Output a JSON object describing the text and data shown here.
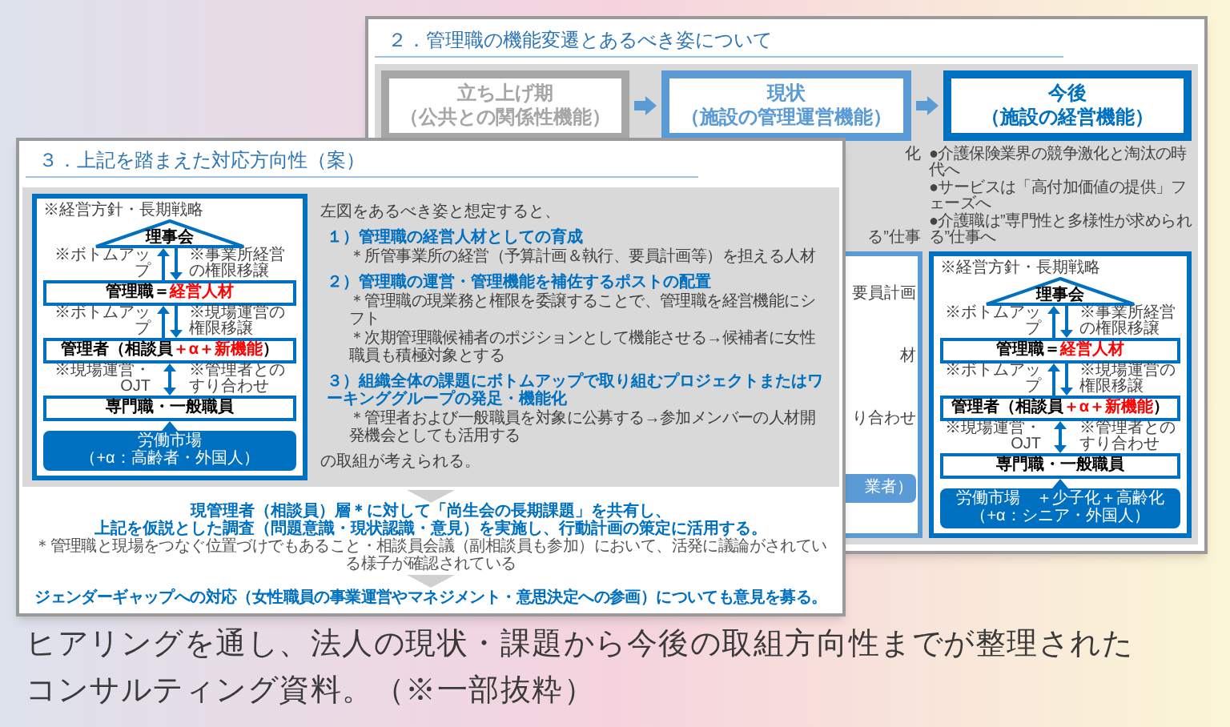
{
  "back_slide": {
    "title": "２．管理職の機能変遷とあるべき姿について",
    "phases": [
      {
        "kind": "past",
        "lines": [
          "立ち上げ期",
          "（公共との関係性機能）"
        ]
      },
      {
        "kind": "present",
        "lines": [
          "現状",
          "（施設の管理運営機能）"
        ]
      },
      {
        "kind": "future",
        "lines": [
          "今後",
          "（施設の経営機能）"
        ]
      }
    ],
    "hidden_bullet_ends": [
      "化",
      "る”仕事"
    ],
    "hidden_panel_texts": [
      "要員計画",
      "材",
      "り合わせ"
    ],
    "hidden_market_text": "業者）",
    "trends": [
      "●介護保険業界の競争激化と淘汰の時代へ",
      "●サービスは「高付加価値の提供」フェーズへ",
      "●介護職は”専門性と多様性が求められる”仕事へ"
    ],
    "diagram": {
      "note": "※経営方針・長期戦略",
      "top": "理事会",
      "links": [
        {
          "kind": "split",
          "left": "※ボトムアップ",
          "right": "※事業所経営の権限移譲"
        },
        {
          "kind": "split",
          "left": "※ボトムアップ",
          "right": "※現場運営の権限移譲"
        },
        {
          "kind": "both",
          "left": "※現場運営・OJT",
          "right": "※管理者とのすり合わせ"
        }
      ],
      "tiers": [
        [
          {
            "text": "管理職＝",
            "emphasis": false
          },
          {
            "text": "経営人材",
            "emphasis": true
          }
        ],
        [
          {
            "text": "管理者（相談員",
            "emphasis": false
          },
          {
            "text": "＋α＋新機能",
            "emphasis": true
          },
          {
            "text": "）",
            "emphasis": false
          }
        ],
        [
          {
            "text": "専門職・一般職員",
            "emphasis": false
          }
        ]
      ],
      "market": [
        "労働市場　＋少子化＋高齢化",
        "（+α：シニア・外国人）"
      ]
    }
  },
  "front_slide": {
    "title": "３．上記を踏まえた対応方向性（案）",
    "diagram": {
      "note": "※経営方針・長期戦略",
      "top": "理事会",
      "links": [
        {
          "kind": "split",
          "left": "※ボトムアップ",
          "right": "※事業所経営の権限移譲"
        },
        {
          "kind": "split",
          "left": "※ボトムアップ",
          "right": "※現場運営の権限移譲"
        },
        {
          "kind": "both",
          "left": "※現場運営・OJT",
          "right": "※管理者とのすり合わせ"
        }
      ],
      "tiers": [
        [
          {
            "text": "管理職＝",
            "emphasis": false
          },
          {
            "text": "経営人材",
            "emphasis": true
          }
        ],
        [
          {
            "text": "管理者（相談員",
            "emphasis": false
          },
          {
            "text": "＋α＋新機能",
            "emphasis": true
          },
          {
            "text": "）",
            "emphasis": false
          }
        ],
        [
          {
            "text": "専門職・一般職員",
            "emphasis": false
          }
        ]
      ],
      "market": [
        "労働市場",
        "（+α：高齢者・外国人）"
      ]
    },
    "intro": "左図をあるべき姿と想定すると、",
    "points": [
      {
        "heading": "１）管理職の経営人材としての育成",
        "bullets": [
          "＊所管事業所の経営（予算計画＆執行、要員計画等）を担える人材"
        ]
      },
      {
        "heading": "２）管理職の運営・管理機能を補佐するポストの配置",
        "bullets": [
          "＊管理職の現業務と権限を委譲することで、管理職を経営機能にシフト",
          "＊次期管理職候補者のポジションとして機能させる→候補者に女性職員も積極対象とする"
        ]
      },
      {
        "heading": "３）組織全体の課題にボトムアップで取り組むプロジェクトまたはワーキンググループの発足・機能化",
        "bullets": [
          "＊管理者および一般職員を対象に公募する→参加メンバーの人材開発機会としても活用する"
        ]
      }
    ],
    "closing": "の取組が考えられる。",
    "proposal": [
      "現管理者（相談員）層＊に対して「尚生会の長期課題」を共有し、",
      "上記を仮説とした調査（問題意識・現状認識・意見）を実施し、行動計画の策定に活用する。"
    ],
    "note": "＊管理職と現場をつなぐ位置づけでもあること・相談員会議（副相談員も参加）において、活発に議論がされている様子が確認されている",
    "final": "ジェンダーギャップへの対応（女性職員の事業運営やマネジメント・意思決定への参画）についても意見を募る。"
  },
  "caption_lines": [
    "ヒアリングを通し、法人の現状・課題から今後の取組方向性までが整理された",
    "コンサルティング資料。（※一部抜粋）"
  ]
}
